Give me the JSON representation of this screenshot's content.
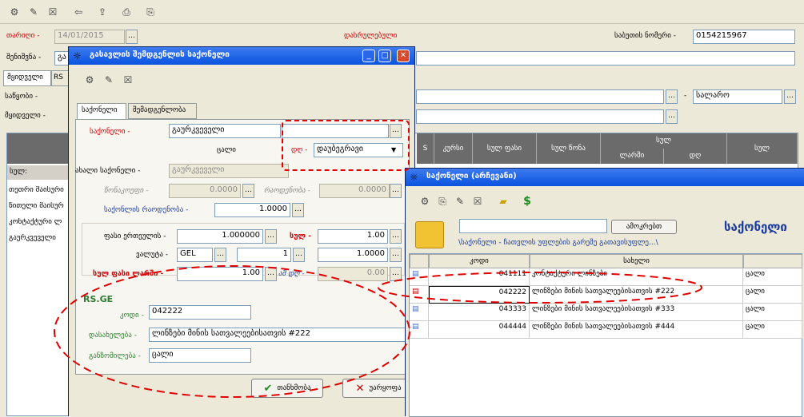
{
  "main": {
    "toolbar_icons": [
      "new-icon",
      "open-icon",
      "close-icon",
      "back-icon",
      "export-icon",
      "print-icon",
      "print2-icon"
    ],
    "date_label": "თარიღი -",
    "date_value": "14/01/2015",
    "status": "დასრულებული",
    "docnum_label": "საბუთის ნომერი -",
    "docnum_value": "0154215967",
    "note_label": "შენიშვნა -",
    "note_value": "გა",
    "tabs": [
      "მყიდველი",
      "RS"
    ],
    "warehouse_label": "საწყობი -",
    "provider_label": "მყიდველი -",
    "currency_value": "სალარო",
    "grid_headers": [
      "S",
      "კურსი",
      "სულ ფასი",
      "სულ წონა",
      "სულ",
      "ლარში",
      "დღ",
      "სულ"
    ],
    "sum_label": "სულ:",
    "left_rows": [
      "თეთრი მაისური",
      "წითელი მაისურ",
      "კონტაქტური ლ",
      "გაურკვეველი"
    ]
  },
  "dialog": {
    "title": "გასავლის შემდგენლის საქონელი",
    "tabs": [
      "საქონელი",
      "შემადგენლობა"
    ],
    "goods_label": "საქონელი -",
    "goods_value": "გაურკვეველი",
    "unit_text": "ცალი",
    "vat_label": "დღ -",
    "vat_value": "დაუბეგრავი",
    "new_goods_label": "ახალი საქონელი -",
    "new_goods_value": "გაურკვეველი",
    "weight_label": "წონაკოეფი -",
    "weight_value": "0.0000",
    "qty2_label": "რაოდენობა -",
    "qty2_value": "0.0000",
    "qty_label": "საქონლის რაოდენობა -",
    "qty_value": "1.0000",
    "price_label": "ფასი ერთეულის -",
    "price_value": "1.000000",
    "sum_label": "სულ -",
    "sum_value": "1.00",
    "currency_label": "ვალუტა -",
    "currency_value": "GEL",
    "rate_value": "1",
    "rate2_value": "1.0000",
    "total_label": "სულ ფასი ლარში -",
    "total_value": "1.00",
    "vat_sum_label": "ამ დღ -",
    "vat_sum_value": "0.00",
    "rsge_title": "RS.GE",
    "code_label": "კოდი -",
    "code_value": "042222",
    "name_label": "დასახელება -",
    "name_value": "ლინზები მინის სათვალეებისათვის #222",
    "unit_label": "განზომილება -",
    "unit_value": "ცალი",
    "ok_label": "თანხმობა",
    "cancel_label": "უარყოფა"
  },
  "picker": {
    "title": "საქონელი (არჩევანი)",
    "search_button": "ამოკრებთ",
    "heading": "საქონელი",
    "path": "\\საქონელი - ჩათვლის უფლების გარეშე გათავისუფლე...\\",
    "col_code": "კოდი",
    "col_name": "სახელი",
    "rows": [
      {
        "code": "041111",
        "name": "კონტაქტური ლინზები",
        "unit": "ცალი"
      },
      {
        "code": "042222",
        "name": "ლინზები მინის სათვალეებისათვის #222",
        "unit": "ცალი"
      },
      {
        "code": "043333",
        "name": "ლინზები მინის სათვალეებისათვის #333",
        "unit": "ცალი"
      },
      {
        "code": "044444",
        "name": "ლინზები მინის სათვალეებისათვის #444",
        "unit": "ცალი"
      }
    ]
  }
}
